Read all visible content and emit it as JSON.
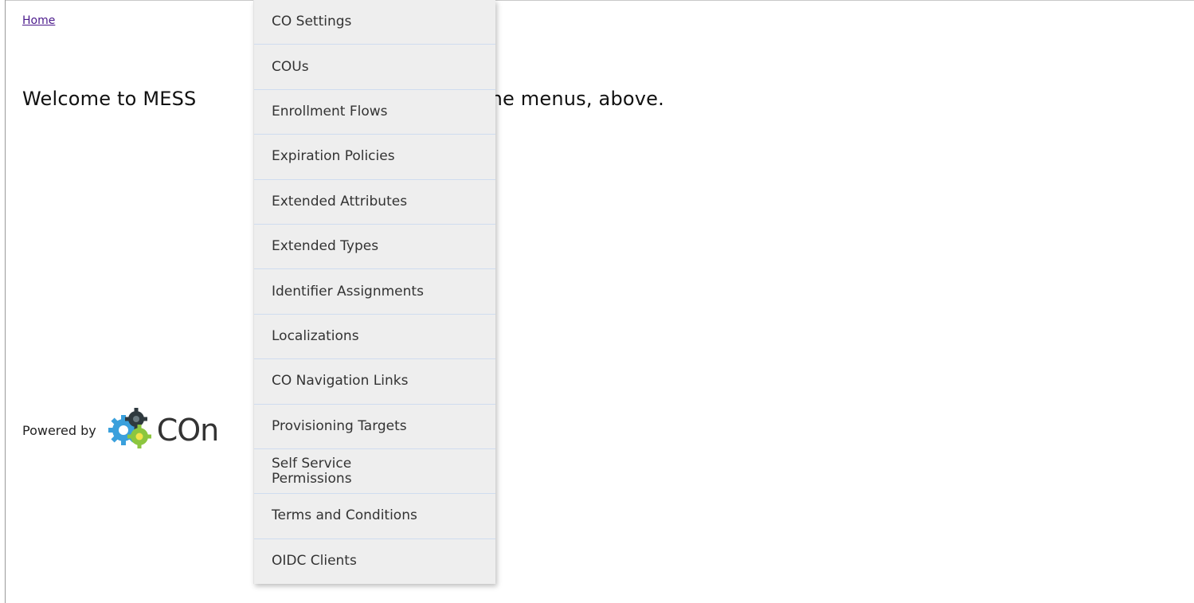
{
  "breadcrumb": {
    "home": "Home"
  },
  "main": {
    "welcome": "Welcome to MESS                             ction from the menus, above."
  },
  "footer": {
    "powered_by": "Powered by",
    "logo_text": "COn",
    "logo_icon": "gears-icon"
  },
  "menu": {
    "items": [
      {
        "label": "CO Settings"
      },
      {
        "label": "COUs"
      },
      {
        "label": "Enrollment Flows"
      },
      {
        "label": "Expiration Policies"
      },
      {
        "label": "Extended Attributes"
      },
      {
        "label": "Extended Types"
      },
      {
        "label": "Identifier Assignments"
      },
      {
        "label": "Localizations"
      },
      {
        "label": "CO Navigation Links"
      },
      {
        "label": "Provisioning Targets"
      },
      {
        "label": "Self Service Permissions"
      },
      {
        "label": "Terms and Conditions"
      },
      {
        "label": "OIDC Clients"
      }
    ]
  },
  "colors": {
    "link": "#4b1a8c",
    "menu_bg": "#eeeeee",
    "menu_divider": "#cfdcef"
  }
}
